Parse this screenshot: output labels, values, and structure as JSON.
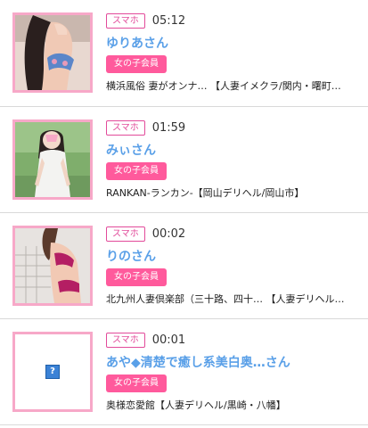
{
  "entries": [
    {
      "platform": "スマホ",
      "time": "05:12",
      "name": "ゆりあさん",
      "member": "女の子会員",
      "shop": "横浜風俗 妻がオンナ…  【人妻イメクラ/関内・曙町…"
    },
    {
      "platform": "スマホ",
      "time": "01:59",
      "name": "みぃさん",
      "member": "女の子会員",
      "shop": "RANKAN-ランカン-【岡山デリヘル/岡山市】"
    },
    {
      "platform": "スマホ",
      "time": "00:02",
      "name": "りのさん",
      "member": "女の子会員",
      "shop": "北九州人妻倶楽部（三十路、四十…  【人妻デリヘル…"
    },
    {
      "platform": "スマホ",
      "time": "00:01",
      "name": "あや◆清楚で癒し系美白奥…さん",
      "member": "女の子会員",
      "shop": "奥様恋愛館【人妻デリヘル/黒崎・八幡】"
    }
  ],
  "broken_image_glyph": "?"
}
